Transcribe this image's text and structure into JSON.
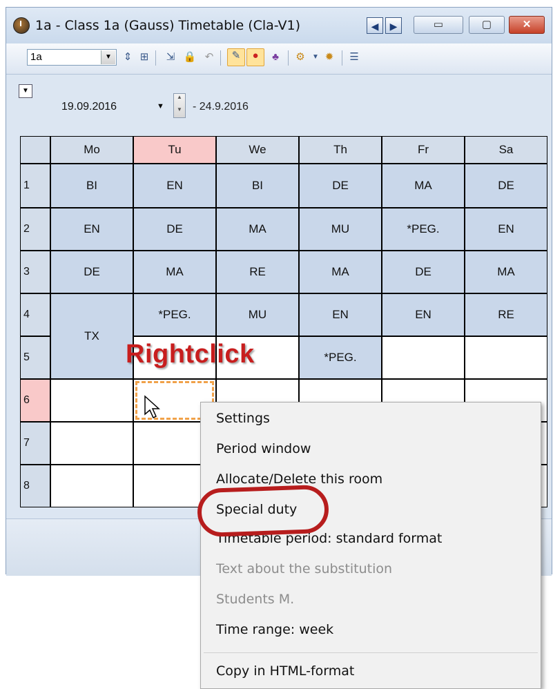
{
  "window": {
    "title": "1a - Class 1a (Gauss)  Timetable  (Cla-V1)"
  },
  "toolbar": {
    "class_selector": "1a"
  },
  "datebar": {
    "start_date": "19.09.2016",
    "end_date": "- 24.9.2016"
  },
  "timetable": {
    "days": [
      "Mo",
      "Tu",
      "We",
      "Th",
      "Fr",
      "Sa"
    ],
    "periods": [
      "1",
      "2",
      "3",
      "4",
      "5",
      "6",
      "7",
      "8"
    ],
    "rows": [
      [
        "BI",
        "EN",
        "BI",
        "DE",
        "MA",
        "DE"
      ],
      [
        "EN",
        "DE",
        "MA",
        "MU",
        "*PEG.",
        "EN"
      ],
      [
        "DE",
        "MA",
        "RE",
        "MA",
        "DE",
        "MA"
      ],
      [
        "TX",
        "*PEG.",
        "MU",
        "EN",
        "EN",
        "RE"
      ],
      [
        "",
        "",
        "",
        "*PEG.",
        "",
        ""
      ]
    ]
  },
  "annotation": {
    "rightclick_label": "Rightclick"
  },
  "context_menu": {
    "items": [
      {
        "label": "Settings",
        "enabled": true
      },
      {
        "label": "Period window",
        "enabled": true
      },
      {
        "label": "Allocate/Delete this room",
        "enabled": true
      },
      {
        "label": "Special duty",
        "enabled": true
      },
      {
        "label": "Timetable period: standard format",
        "enabled": true
      },
      {
        "label": "Text about the substitution",
        "enabled": false
      },
      {
        "label": "Students M.",
        "enabled": false
      },
      {
        "label": "Time range: week",
        "enabled": true
      },
      {
        "label": "Copy in HTML-format",
        "enabled": true
      }
    ]
  },
  "colors": {
    "filled_cell": "#c9d7ea",
    "today_header": "#f9c9c9",
    "highlight_ring": "#b71d1d",
    "rightclick_text": "#c81e1e"
  }
}
